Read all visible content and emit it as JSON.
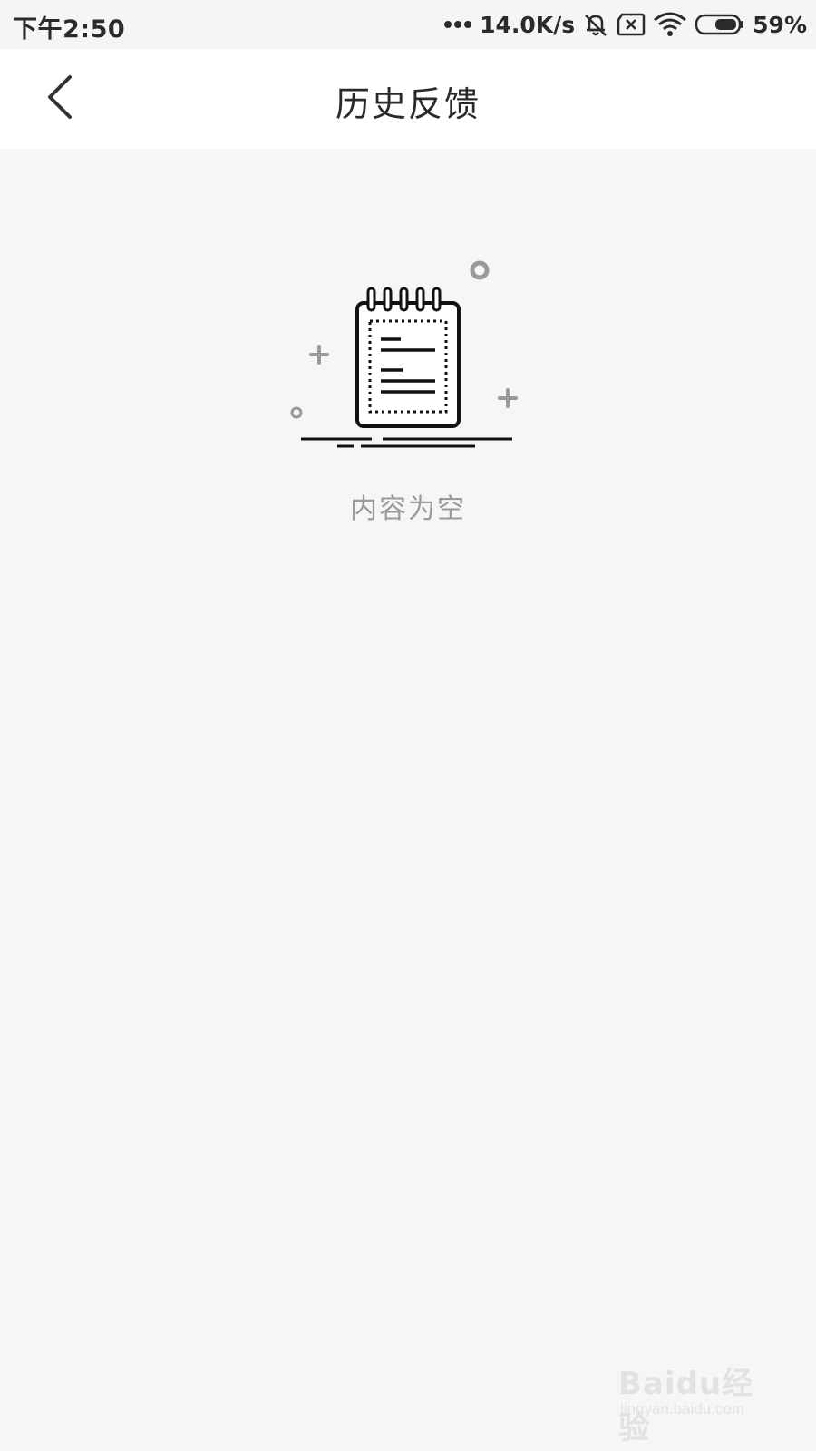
{
  "status_bar": {
    "time": "下午2:50",
    "net_speed": "14.0K/s",
    "battery_percent": "59%",
    "icons": [
      "signal-dots-icon",
      "mute-bell-icon",
      "sim-x-icon",
      "wifi-icon",
      "battery-icon"
    ]
  },
  "header": {
    "title": "历史反馈",
    "back_icon": "chevron-left-icon"
  },
  "empty_state": {
    "icon": "notepad-icon",
    "text": "内容为空"
  },
  "watermark": {
    "brand": "Baidu经验",
    "url": "jingyan.baidu.com"
  },
  "colors": {
    "background": "#f5f6f6",
    "header_bg": "#ffffff",
    "title": "#2a2a2a",
    "empty_text": "#9a9a9a"
  }
}
